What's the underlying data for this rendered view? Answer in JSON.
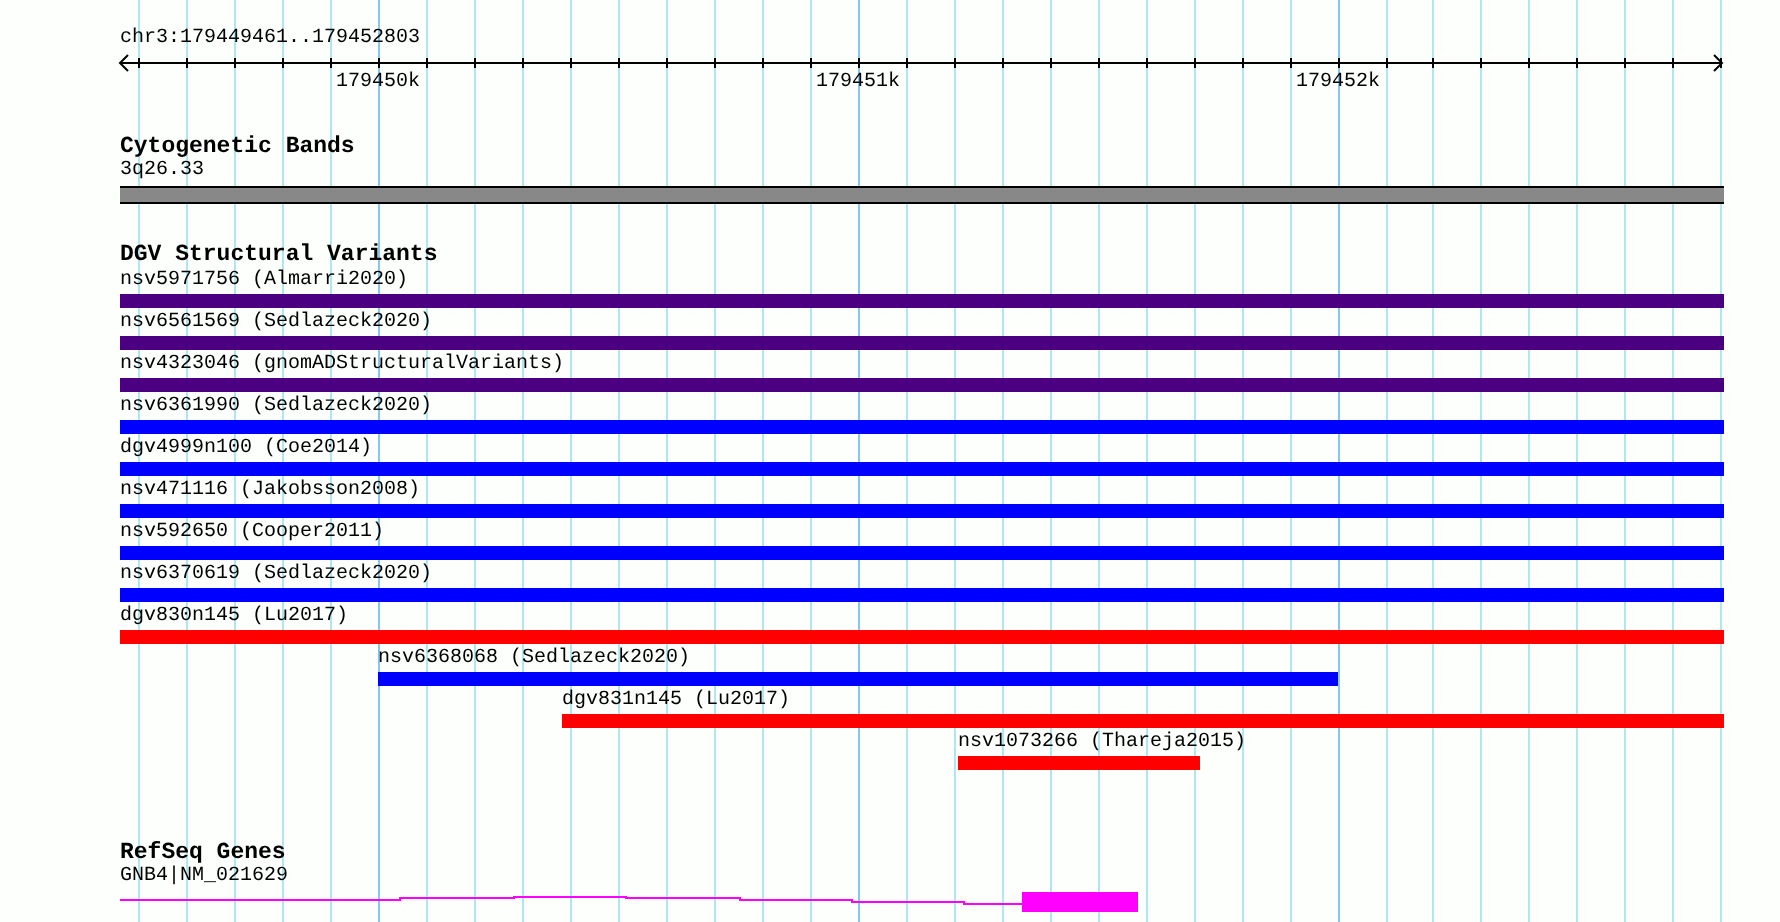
{
  "ruler": {
    "location": "chr3:179449461..179452803",
    "ticks": [
      "179450k",
      "179451k",
      "179452k"
    ]
  },
  "tracks": [
    {
      "kind": "cytoband",
      "title": "Cytogenetic Bands",
      "features": [
        {
          "label": "3q26.33"
        }
      ]
    },
    {
      "kind": "variants",
      "title": "DGV Structural Variants",
      "features": [
        {
          "label": "nsv5971756 (Almarri2020)",
          "color": "#4b0082"
        },
        {
          "label": "nsv6561569 (Sedlazeck2020)",
          "color": "#4b0082"
        },
        {
          "label": "nsv4323046 (gnomADStructuralVariants)",
          "color": "#4b0082"
        },
        {
          "label": "nsv6361990 (Sedlazeck2020)",
          "color": "#0000ff"
        },
        {
          "label": "dgv4999n100 (Coe2014)",
          "color": "#0000ff"
        },
        {
          "label": "nsv471116 (Jakobsson2008)",
          "color": "#0000ff"
        },
        {
          "label": "nsv592650 (Cooper2011)",
          "color": "#0000ff"
        },
        {
          "label": "nsv6370619 (Sedlazeck2020)",
          "color": "#0000ff"
        },
        {
          "label": "dgv830n145 (Lu2017)",
          "color": "#ff0000"
        },
        {
          "label": "nsv6368068 (Sedlazeck2020)",
          "color": "#0000ff"
        },
        {
          "label": "dgv831n145 (Lu2017)",
          "color": "#ff0000"
        },
        {
          "label": "nsv1073266 (Thareja2015)",
          "color": "#ff0000"
        }
      ]
    },
    {
      "kind": "gene",
      "title": "RefSeq Genes",
      "features": [
        {
          "label": "GNB4|NM_021629"
        }
      ]
    }
  ]
}
